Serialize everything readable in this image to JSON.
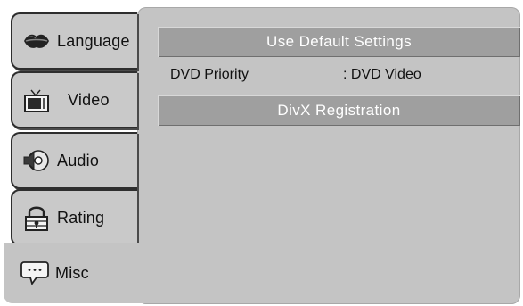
{
  "tabs": [
    {
      "label": "Language",
      "icon": "lips-icon"
    },
    {
      "label": "Video",
      "icon": "tv-icon"
    },
    {
      "label": "Audio",
      "icon": "speaker-disc-icon"
    },
    {
      "label": "Rating",
      "icon": "padlock-icon"
    },
    {
      "label": "Misc",
      "icon": "speech-bubble-icon"
    }
  ],
  "menu": {
    "default_settings": "Use Default Settings",
    "dvd_priority_label": "DVD Priority",
    "dvd_priority_value": ": DVD Video",
    "divx_registration": "DivX Registration"
  },
  "colors": {
    "panel": "#c4c4c4",
    "button": "#9f9f9f",
    "tab_border": "#2e2e2e"
  }
}
